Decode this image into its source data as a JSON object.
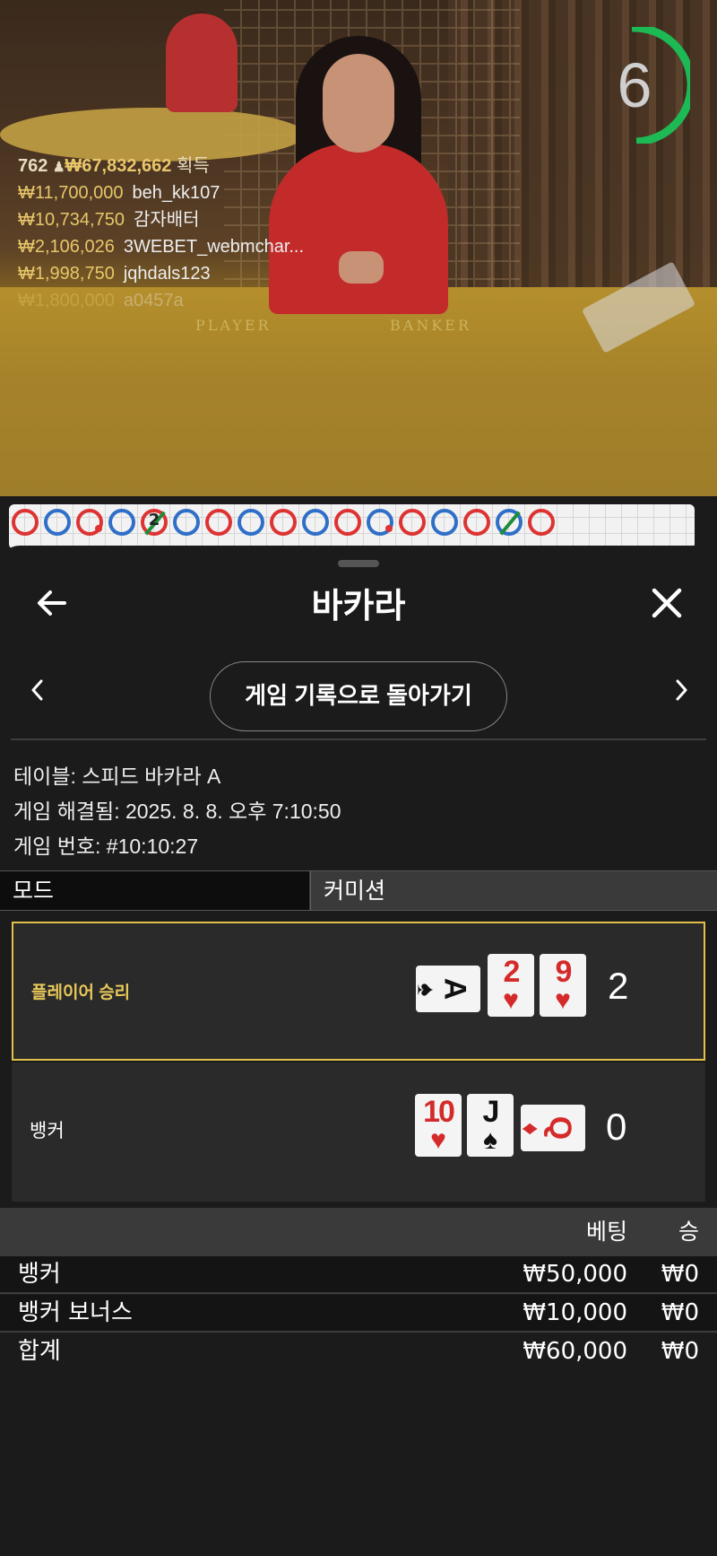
{
  "live": {
    "timer": "6",
    "felt_player": "PLAYER",
    "felt_banker": "BANKER",
    "winners_count": "762",
    "winners_total": "₩67,832,662",
    "winners_label": "획득",
    "winners": [
      {
        "amount": "₩11,700,000",
        "name": "beh_kk107"
      },
      {
        "amount": "₩10,734,750",
        "name": "감자배터"
      },
      {
        "amount": "₩2,106,026",
        "name": "3WEBET_webmchar..."
      },
      {
        "amount": "₩1,998,750",
        "name": "jqhdals123"
      },
      {
        "amount": "₩1,800,000",
        "name": "a0457a"
      }
    ],
    "road_tie_number": "2"
  },
  "header": {
    "title": "바카라"
  },
  "history_button": "게임 기록으로 돌아가기",
  "info": {
    "table": "테이블: 스피드 바카라 A",
    "resolved": "게임 해결됨: 2025. 8. 8. 오후 7:10:50",
    "game_no": "게임 번호: #10:10:27"
  },
  "mode": {
    "label": "모드",
    "value": "커미션"
  },
  "results": {
    "player": {
      "label": "플레이어 승리",
      "score": "2",
      "cards": [
        {
          "rank": "A",
          "suit": "♠",
          "color": "#111111"
        },
        {
          "rank": "2",
          "suit": "♥",
          "color": "#d42a2a"
        },
        {
          "rank": "9",
          "suit": "♥",
          "color": "#d42a2a"
        }
      ]
    },
    "banker": {
      "label": "뱅커",
      "score": "0",
      "cards": [
        {
          "rank": "10",
          "suit": "♥",
          "color": "#d42a2a"
        },
        {
          "rank": "J",
          "suit": "♠",
          "color": "#111111"
        },
        {
          "rank": "Q",
          "suit": "♦",
          "color": "#d42a2a"
        }
      ]
    }
  },
  "bets": {
    "headers": {
      "bet": "베팅",
      "win": "승"
    },
    "rows": [
      {
        "name": "뱅커",
        "bet": "₩50,000",
        "win": "₩0"
      },
      {
        "name": "뱅커 보너스",
        "bet": "₩10,000",
        "win": "₩0"
      },
      {
        "name": "합계",
        "bet": "₩60,000",
        "win": "₩0"
      }
    ]
  },
  "colors": {
    "accent_gold": "#e2c04a",
    "timer_green": "#1db954",
    "panel_bg": "#1b1b1b",
    "player_blue": "#2f6fc8",
    "banker_red": "#dd3333"
  }
}
